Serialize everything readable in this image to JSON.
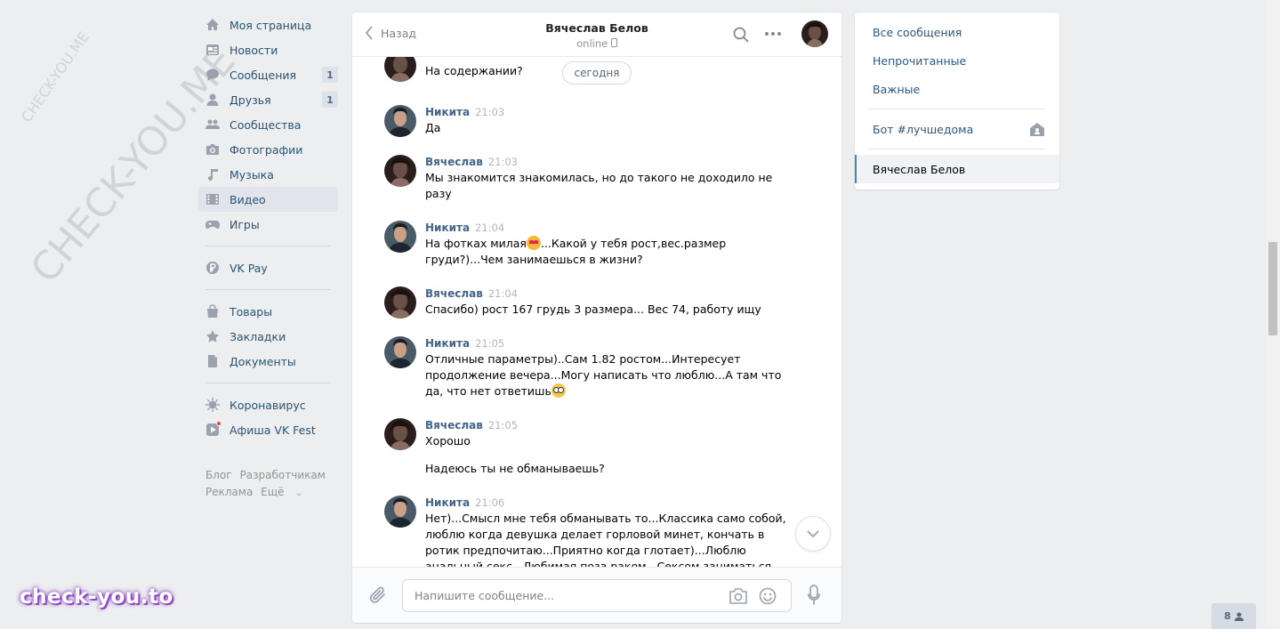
{
  "leftnav": {
    "items": [
      {
        "label": "Моя страница",
        "icon": "home-icon"
      },
      {
        "label": "Новости",
        "icon": "news-icon"
      },
      {
        "label": "Сообщения",
        "icon": "messages-icon",
        "badge": "1"
      },
      {
        "label": "Друзья",
        "icon": "friends-icon",
        "badge": "1"
      },
      {
        "label": "Сообщества",
        "icon": "communities-icon"
      },
      {
        "label": "Фотографии",
        "icon": "camera-icon"
      },
      {
        "label": "Музыка",
        "icon": "music-icon"
      },
      {
        "label": "Видео",
        "icon": "video-icon",
        "active": true
      },
      {
        "label": "Игры",
        "icon": "gamepad-icon"
      }
    ],
    "group2": [
      {
        "label": "VK Pay",
        "icon": "vkpay-icon"
      }
    ],
    "group3": [
      {
        "label": "Товары",
        "icon": "bag-icon"
      },
      {
        "label": "Закладки",
        "icon": "star-icon"
      },
      {
        "label": "Документы",
        "icon": "document-icon"
      }
    ],
    "group4": [
      {
        "label": "Коронавирус",
        "icon": "virus-icon"
      },
      {
        "label": "Афиша VK Fest",
        "icon": "play-icon"
      }
    ],
    "footer": {
      "blog": "Блог",
      "developers": "Разработчикам",
      "ads": "Реклама",
      "more": "Ещё"
    }
  },
  "chat": {
    "back_label": "Назад",
    "peer_name": "Вячеслав Белов",
    "peer_status": "online",
    "date_pill": "сегодня",
    "messages": [
      {
        "author": "",
        "time": "",
        "lines": [
          "На содержании?"
        ],
        "avatar": "female"
      },
      {
        "author": "Никита",
        "time": "21:03",
        "lines": [
          "Да"
        ],
        "avatar": "male"
      },
      {
        "author": "Вячеслав",
        "time": "21:03",
        "lines": [
          "Мы знакомится знакомилась, но до такого не доходило не",
          "разу"
        ],
        "avatar": "female"
      },
      {
        "author": "Никита",
        "time": "21:04",
        "lines": [
          "На фотках милая",
          "...Какой у тебя рост,вес.размер",
          "груди?)...Чем занимаешься в жизни?"
        ],
        "avatar": "male"
      },
      {
        "author": "Вячеслав",
        "time": "21:04",
        "lines": [
          "Спасибо) рост 167 грудь 3 размера... Вес 74, работу ищу"
        ],
        "avatar": "female"
      },
      {
        "author": "Никита",
        "time": "21:05",
        "lines": [
          "Отличные параметры)..Сам 1.82 ростом...Интересует",
          "продолжение вечера...Могу написать что люблю...А там что",
          "да, что нет ответишь"
        ],
        "avatar": "male"
      },
      {
        "author": "Вячеслав",
        "time": "21:05",
        "lines": [
          "Хорошо",
          "Надеюсь ты не обманываешь?"
        ],
        "avatar": "female"
      },
      {
        "author": "Никита",
        "time": "21:06",
        "lines": [
          "Нет)...Смысл мне тебя обманывать то...Классика само собой,",
          "люблю когда девушка делает горловой минет, кончать в",
          "ротик предпочитаю...Приятно когда глотает)...Люблю",
          "анальный секс...Любимая поза раком...Сексом заниматься"
        ],
        "avatar": "male"
      }
    ],
    "composer_placeholder": "Напишите сообщение..."
  },
  "rightpanel": {
    "items": [
      "Все сообщения",
      "Непрочитанные",
      "Важные"
    ],
    "bot": "Бот #лучшедома",
    "selected": "Вячеслав Белов"
  },
  "friends_counter": "8",
  "watermarks": {
    "small": "CHECK-YOU.ME",
    "big": "CHECK-YOU.ME",
    "brand": "check-you.to"
  },
  "colors": {
    "link": "#2a5885",
    "author": "#42648b",
    "bg": "#edeef0",
    "accent": "#5181b8"
  }
}
